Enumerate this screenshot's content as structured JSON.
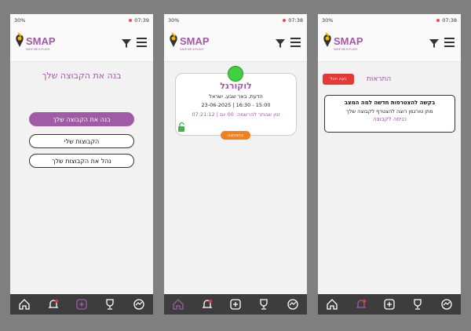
{
  "status": {
    "battery": "30%",
    "time1": "07:39",
    "time2": "07:38",
    "time3": "07:38"
  },
  "brand": {
    "name": "SMAP",
    "tagline": "SAVE ME A PLACE"
  },
  "screen1": {
    "title": "בנה את הקבוצה שלך",
    "buttons": [
      "בנה את הקבוצה שלך",
      "הקבוצות שלי",
      "נהל את הקבוצות שלך"
    ]
  },
  "screen2": {
    "card": {
      "title": "לוקורגל",
      "location": "הדעת, באר שבע, ישראל",
      "datetime": "23-06-2025 | 16:30 - 15:00",
      "timer": "זמן שנותר להרשמה: 00 יום | 07:21:12",
      "status": "בהמתנה"
    }
  },
  "screen3": {
    "title": "התראות",
    "clear": "נקה הכל",
    "notification": {
      "line1": "בקשה להצטרפות חדשה למה המצב",
      "line2": "מתן טורגמן רוצה להצטרף לקבוצה שלך",
      "line3": "כניסה לקבוצה"
    }
  },
  "colors": {
    "accent": "#a05aa6",
    "danger": "#e53935",
    "orange": "#f08020",
    "nav": "#3d3d3d"
  }
}
